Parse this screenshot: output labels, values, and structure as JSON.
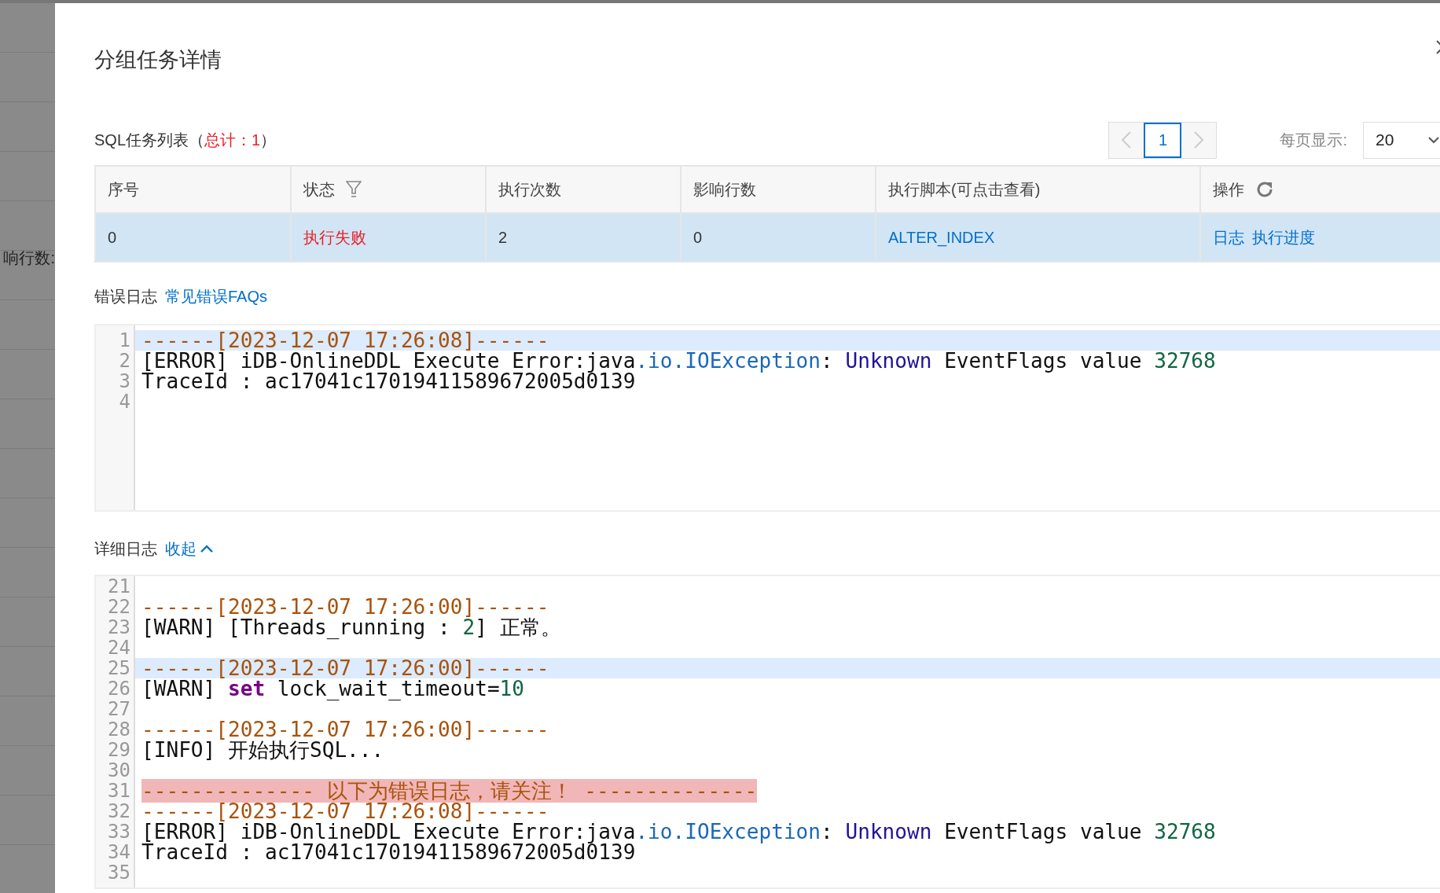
{
  "backdrop": {
    "label": "响行数:"
  },
  "dialog": {
    "title": "分组任务详情"
  },
  "task_list": {
    "heading": "SQL任务列表（",
    "total": "总计：1",
    "heading_end": "）"
  },
  "pagination": {
    "pages": [
      {
        "label": "1",
        "selected": true
      }
    ],
    "page_size_label": "每页显示:",
    "page_size": "20"
  },
  "table": {
    "columns": [
      {
        "label": "序号",
        "kind": "plain"
      },
      {
        "label": "状态",
        "kind": "filter"
      },
      {
        "label": "执行次数",
        "kind": "plain"
      },
      {
        "label": "影响行数",
        "kind": "plain"
      },
      {
        "label": "执行脚本(可点击查看)",
        "kind": "plain"
      },
      {
        "label": "操作",
        "kind": "refresh"
      }
    ],
    "rows": [
      {
        "selected": true,
        "cells": [
          {
            "kind": "text",
            "text": "0"
          },
          {
            "kind": "status",
            "text": "执行失败"
          },
          {
            "kind": "text",
            "text": "2"
          },
          {
            "kind": "text",
            "text": "0"
          },
          {
            "kind": "link",
            "text": "ALTER_INDEX"
          },
          {
            "kind": "actions",
            "links": [
              "日志",
              "执行进度"
            ]
          }
        ]
      }
    ]
  },
  "error_log": {
    "label": "错误日志",
    "link": "常见错误FAQs",
    "lines": [
      {
        "number": "1",
        "highlighted": true,
        "tokens": [
          {
            "kind": "time",
            "text": "------[2023-12-07 17:26:08]------"
          }
        ]
      },
      {
        "number": "2",
        "highlighted": false,
        "tokens": [
          {
            "kind": "plain",
            "text": "[ERROR] iDB-OnlineDDL Execute Error:java"
          },
          {
            "kind": "prop",
            "text": ".io.IOException"
          },
          {
            "kind": "plain",
            "text": ": "
          },
          {
            "kind": "variable",
            "text": "Unknown"
          },
          {
            "kind": "plain",
            "text": " EventFlags value "
          },
          {
            "kind": "number",
            "text": "32768"
          }
        ]
      },
      {
        "number": "3",
        "highlighted": false,
        "tokens": [
          {
            "kind": "plain",
            "text": "TraceId : ac17041c17019411589672005d0139"
          }
        ]
      },
      {
        "number": "4",
        "highlighted": false
      }
    ]
  },
  "detail_log": {
    "label": "详细日志",
    "toggle": "收起",
    "lines": [
      {
        "number": "21",
        "highlighted": false
      },
      {
        "number": "22",
        "highlighted": false,
        "tokens": [
          {
            "kind": "time",
            "text": "------[2023-12-07 17:26:00]------"
          }
        ]
      },
      {
        "number": "23",
        "highlighted": false,
        "tokens": [
          {
            "kind": "plain",
            "text": "[WARN] [Threads_running : "
          },
          {
            "kind": "number",
            "text": "2"
          },
          {
            "kind": "plain",
            "text": "] 正常。"
          }
        ]
      },
      {
        "number": "24",
        "highlighted": false
      },
      {
        "number": "25",
        "highlighted": true,
        "tokens": [
          {
            "kind": "time",
            "text": "------[2023-12-07 17:26:00]------"
          }
        ]
      },
      {
        "number": "26",
        "highlighted": false,
        "tokens": [
          {
            "kind": "plain",
            "text": "[WARN] "
          },
          {
            "kind": "keyword",
            "text": "set"
          },
          {
            "kind": "plain",
            "text": " lock_wait_timeout="
          },
          {
            "kind": "number",
            "text": "10"
          }
        ]
      },
      {
        "number": "27",
        "highlighted": false
      },
      {
        "number": "28",
        "highlighted": false,
        "tokens": [
          {
            "kind": "time",
            "text": "------[2023-12-07 17:26:00]------"
          }
        ]
      },
      {
        "number": "29",
        "highlighted": false,
        "tokens": [
          {
            "kind": "plain",
            "text": "[INFO] 开始执行SQL..."
          }
        ]
      },
      {
        "number": "30",
        "highlighted": false
      },
      {
        "number": "31",
        "highlighted": false,
        "tokens": [
          {
            "kind": "alert",
            "text": "-------------- 以下为错误日志，请关注！ --------------"
          }
        ]
      },
      {
        "number": "32",
        "highlighted": false,
        "tokens": [
          {
            "kind": "time",
            "text": "------[2023-12-07 17:26:08]------"
          }
        ]
      },
      {
        "number": "33",
        "highlighted": false,
        "tokens": [
          {
            "kind": "plain",
            "text": "[ERROR] iDB-OnlineDDL Execute Error:java"
          },
          {
            "kind": "prop",
            "text": ".io.IOException"
          },
          {
            "kind": "plain",
            "text": ": "
          },
          {
            "kind": "variable",
            "text": "Unknown"
          },
          {
            "kind": "plain",
            "text": " EventFlags value "
          },
          {
            "kind": "number",
            "text": "32768"
          }
        ]
      },
      {
        "number": "34",
        "highlighted": false,
        "tokens": [
          {
            "kind": "plain",
            "text": "TraceId : ac17041c17019411589672005d0139"
          }
        ]
      },
      {
        "number": "35",
        "highlighted": false
      }
    ]
  }
}
